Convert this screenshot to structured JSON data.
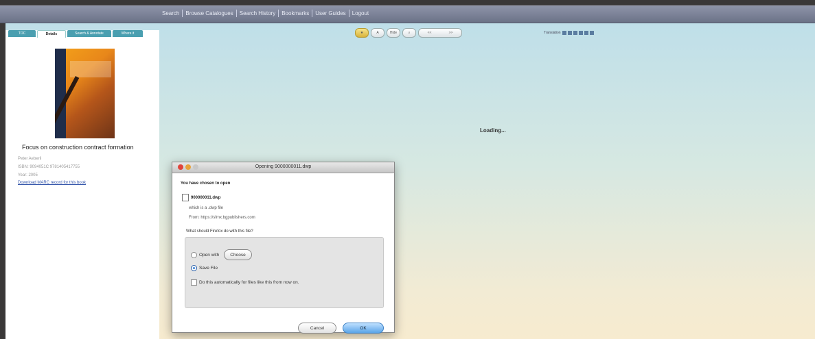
{
  "topnav": {
    "items": [
      "Search",
      "Browse Catalogues",
      "Search History",
      "Bookmarks",
      "User Guides",
      "Logout"
    ]
  },
  "left_panel": {
    "tabs": [
      "TOC",
      "Details",
      "Search & Annotate",
      "Where it"
    ],
    "book_title": "Focus on construction contract formation",
    "meta": {
      "authors": "Peter Aeberli",
      "isbn": "ISBN: 9094051C 9781405417755",
      "year": "Year: 2005",
      "download_link": "Download MARC record for this book"
    }
  },
  "toolbar": {
    "buttons": [
      "home-icon",
      "A",
      "Hide",
      "zoom-icon"
    ],
    "pager": [
      "<<",
      ">>"
    ],
    "translation_label": "Translation"
  },
  "loading_text": "Loading...",
  "dialog": {
    "title": "Opening 9000000011.dwp",
    "chosen_label": "You have chosen to open",
    "file_name": "900000011.dwp",
    "which_is": "which is a .dwp file",
    "from": "From: https://sfmx.bgpublishers.com",
    "question": "What should Firefox do with this file?",
    "open_with_label": "Open with",
    "choose_label": "Choose",
    "save_file_label": "Save File",
    "auto_label": "Do this automatically for files like this from now on.",
    "cancel_label": "Cancel",
    "ok_label": "OK"
  },
  "colors": {
    "accent_tab": "#4a9fb0",
    "ok_button": "#5aa5e8",
    "close_light": "#e0443c"
  }
}
